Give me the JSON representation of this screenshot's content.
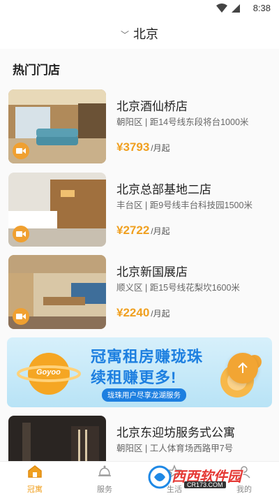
{
  "status_bar": {
    "time": "8:38"
  },
  "header": {
    "city": "北京"
  },
  "section": {
    "title": "热门门店"
  },
  "stores": [
    {
      "name": "北京酒仙桥店",
      "address": "朝阳区 | 距14号线东段将台1000米",
      "price": "¥3793",
      "unit": "/月起"
    },
    {
      "name": "北京总部基地二店",
      "address": "丰台区 | 距9号线丰台科技园1500米",
      "price": "¥2722",
      "unit": "/月起"
    },
    {
      "name": "北京新国展店",
      "address": "顺义区 | 距15号线花梨坎1600米",
      "price": "¥2240",
      "unit": "/月起"
    },
    {
      "name": "北京东迎坊服务式公寓",
      "address": "朝阳区 | 工人体育场西路甲7号",
      "price": "",
      "unit": ""
    }
  ],
  "banner": {
    "line1": "冠寓租房赚珑珠",
    "line2": "续租赚更多!",
    "sub": "珑珠用户尽享龙湖服务",
    "logo": "Goyoo"
  },
  "tabs": [
    {
      "label": "冠寓",
      "icon": "home-icon",
      "active": true
    },
    {
      "label": "服务",
      "icon": "bell-icon",
      "active": false
    },
    {
      "label": "生活",
      "icon": "star-icon",
      "active": false
    },
    {
      "label": "我的",
      "icon": "user-icon",
      "active": false
    }
  ],
  "watermark": {
    "text": "西西软件园",
    "url": "CR173.COM"
  },
  "colors": {
    "accent": "#f0a020",
    "banner_blue": "#1d7fe0"
  }
}
